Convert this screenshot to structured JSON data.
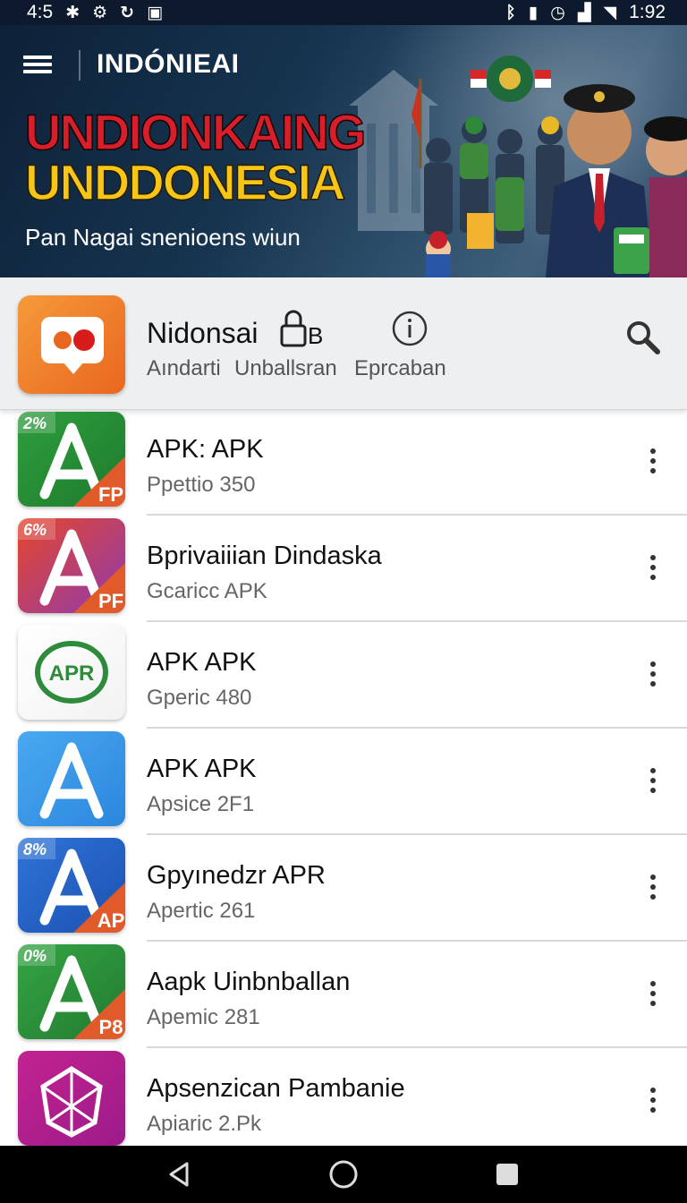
{
  "status_bar": {
    "left_time": "4:5",
    "right_time": "1:92"
  },
  "header": {
    "app_title": "INDÓNIEAI",
    "headline_1": "UNDIONKAING",
    "headline_2": "UNDDONESIA",
    "subtitle": "Pan Nagai snenioens wiun"
  },
  "featured": {
    "name": "Nidonsai",
    "lock_label": "B",
    "meta_1": "Aındarti",
    "meta_2": "Unballsran",
    "meta_3": "Eprcaban",
    "icons": [
      "chat-bubble-icon",
      "lock-icon",
      "info-icon",
      "search-icon"
    ]
  },
  "apps": [
    {
      "title": "APK: APK",
      "subtitle": "Ppettio 350",
      "badge_top": "2%",
      "badge_corner": "FP",
      "colors": [
        "#2e9e3e",
        "#1e7a2c"
      ]
    },
    {
      "title": "Bprivaiiian Dindaska",
      "subtitle": "Gcaricc APK",
      "badge_top": "6%",
      "badge_corner": "PF",
      "colors": [
        "#e6462a",
        "#8e3bb0"
      ]
    },
    {
      "title": "APK APK",
      "subtitle": "Gperic 480",
      "badge_top": "",
      "badge_corner": "APR",
      "colors": [
        "#ffffff",
        "#f2f2f2"
      ]
    },
    {
      "title": "APK APK",
      "subtitle": "Apsice 2F1",
      "badge_top": "",
      "badge_corner": "",
      "colors": [
        "#49a9f0",
        "#2b86dd"
      ]
    },
    {
      "title": "Gpyınedzr APR",
      "subtitle": "Apertic 261",
      "badge_top": "8%",
      "badge_corner": "AP",
      "colors": [
        "#2f74d8",
        "#1b50b0"
      ]
    },
    {
      "title": "Aapk Uinbnballan",
      "subtitle": "Apemic 281",
      "badge_top": "0%",
      "badge_corner": "P8",
      "colors": [
        "#35a544",
        "#217a30"
      ]
    },
    {
      "title": "Apsenzican Pambanie",
      "subtitle": "Apiaric 2.Pk",
      "badge_top": "",
      "badge_corner": "",
      "colors": [
        "#c2238f",
        "#9c1b8a"
      ]
    }
  ],
  "nav": {
    "icons": [
      "back-icon",
      "home-icon",
      "recents-icon"
    ]
  }
}
